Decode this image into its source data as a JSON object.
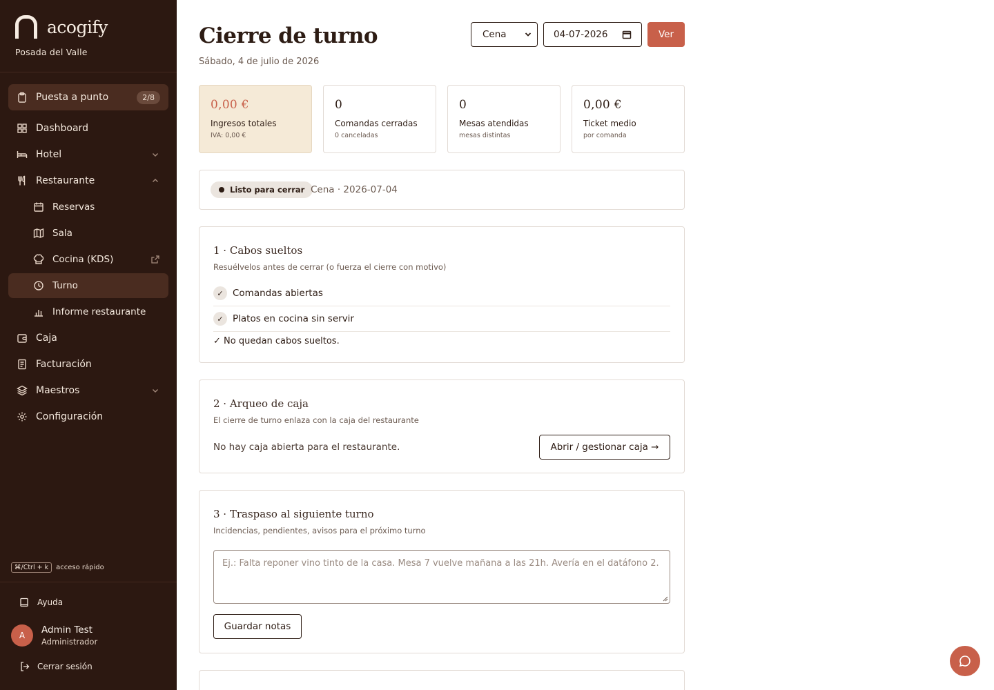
{
  "brand": {
    "name": "acogify",
    "org": "Posada del Valle"
  },
  "sidebar": {
    "items": [
      {
        "label": "Puesta a punto",
        "badge": "2/8",
        "icon": "clipboard-icon"
      },
      {
        "label": "Dashboard",
        "icon": "grid-icon"
      },
      {
        "label": "Hotel",
        "icon": "bed-icon"
      },
      {
        "label": "Restaurante",
        "icon": "utensils-icon"
      },
      {
        "label": "Reservas",
        "icon": "calendar-icon"
      },
      {
        "label": "Sala",
        "icon": "map-icon"
      },
      {
        "label": "Cocina (KDS)",
        "icon": "chef-hat-icon"
      },
      {
        "label": "Turno",
        "icon": "clock-icon"
      },
      {
        "label": "Informe restaurante",
        "icon": "bar-chart-icon"
      },
      {
        "label": "Caja",
        "icon": "wallet-icon"
      },
      {
        "label": "Facturación",
        "icon": "receipt-icon"
      },
      {
        "label": "Maestros",
        "icon": "layers-icon"
      },
      {
        "label": "Configuración",
        "icon": "gear-icon"
      }
    ],
    "shortcut_key": "⌘/Ctrl + k",
    "shortcut_label": "acceso rápido",
    "help": "Ayuda",
    "user": {
      "initial": "A",
      "name": "Admin Test",
      "role": "Administrador"
    },
    "logout": "Cerrar sesión"
  },
  "header": {
    "title": "Cierre de turno",
    "subtitle": "Sábado, 4 de julio de 2026",
    "service_select": "Cena",
    "date_value": "04-07-2026",
    "view_button": "Ver"
  },
  "kpis": [
    {
      "value": "0,00 €",
      "label": "Ingresos totales",
      "sub": "IVA: 0,00 €"
    },
    {
      "value": "0",
      "label": "Comandas cerradas",
      "sub": "0 canceladas"
    },
    {
      "value": "0",
      "label": "Mesas atendidas",
      "sub": "mesas distintas"
    },
    {
      "value": "0,00 €",
      "label": "Ticket medio",
      "sub": "por comanda"
    }
  ],
  "status": {
    "pill": "Listo para cerrar",
    "text": "Cena · 2026-07-04"
  },
  "section1": {
    "title": "1 · Cabos sueltos",
    "desc": "Resuélvelos antes de cerrar (o fuerza el cierre con motivo)",
    "checks": [
      "Comandas abiertas",
      "Platos en cocina sin servir"
    ],
    "ok": "✓ No quedan cabos sueltos."
  },
  "section2": {
    "title": "2 · Arqueo de caja",
    "desc": "El cierre de turno enlaza con la caja del restaurante",
    "message": "No hay caja abierta para el restaurante.",
    "button": "Abrir / gestionar caja →"
  },
  "section3": {
    "title": "3 · Traspaso al siguiente turno",
    "desc": "Incidencias, pendientes, avisos para el próximo turno",
    "placeholder": "Ej.: Falta reponer vino tinto de la casa. Mesa 7 vuelve mañana a las 21h. Avería en el datáfono 2.",
    "button": "Guardar notas"
  },
  "colors": {
    "sidebar": "#2c1811",
    "accent": "#c8604a",
    "kpi_highlight": "#f5ead7"
  }
}
